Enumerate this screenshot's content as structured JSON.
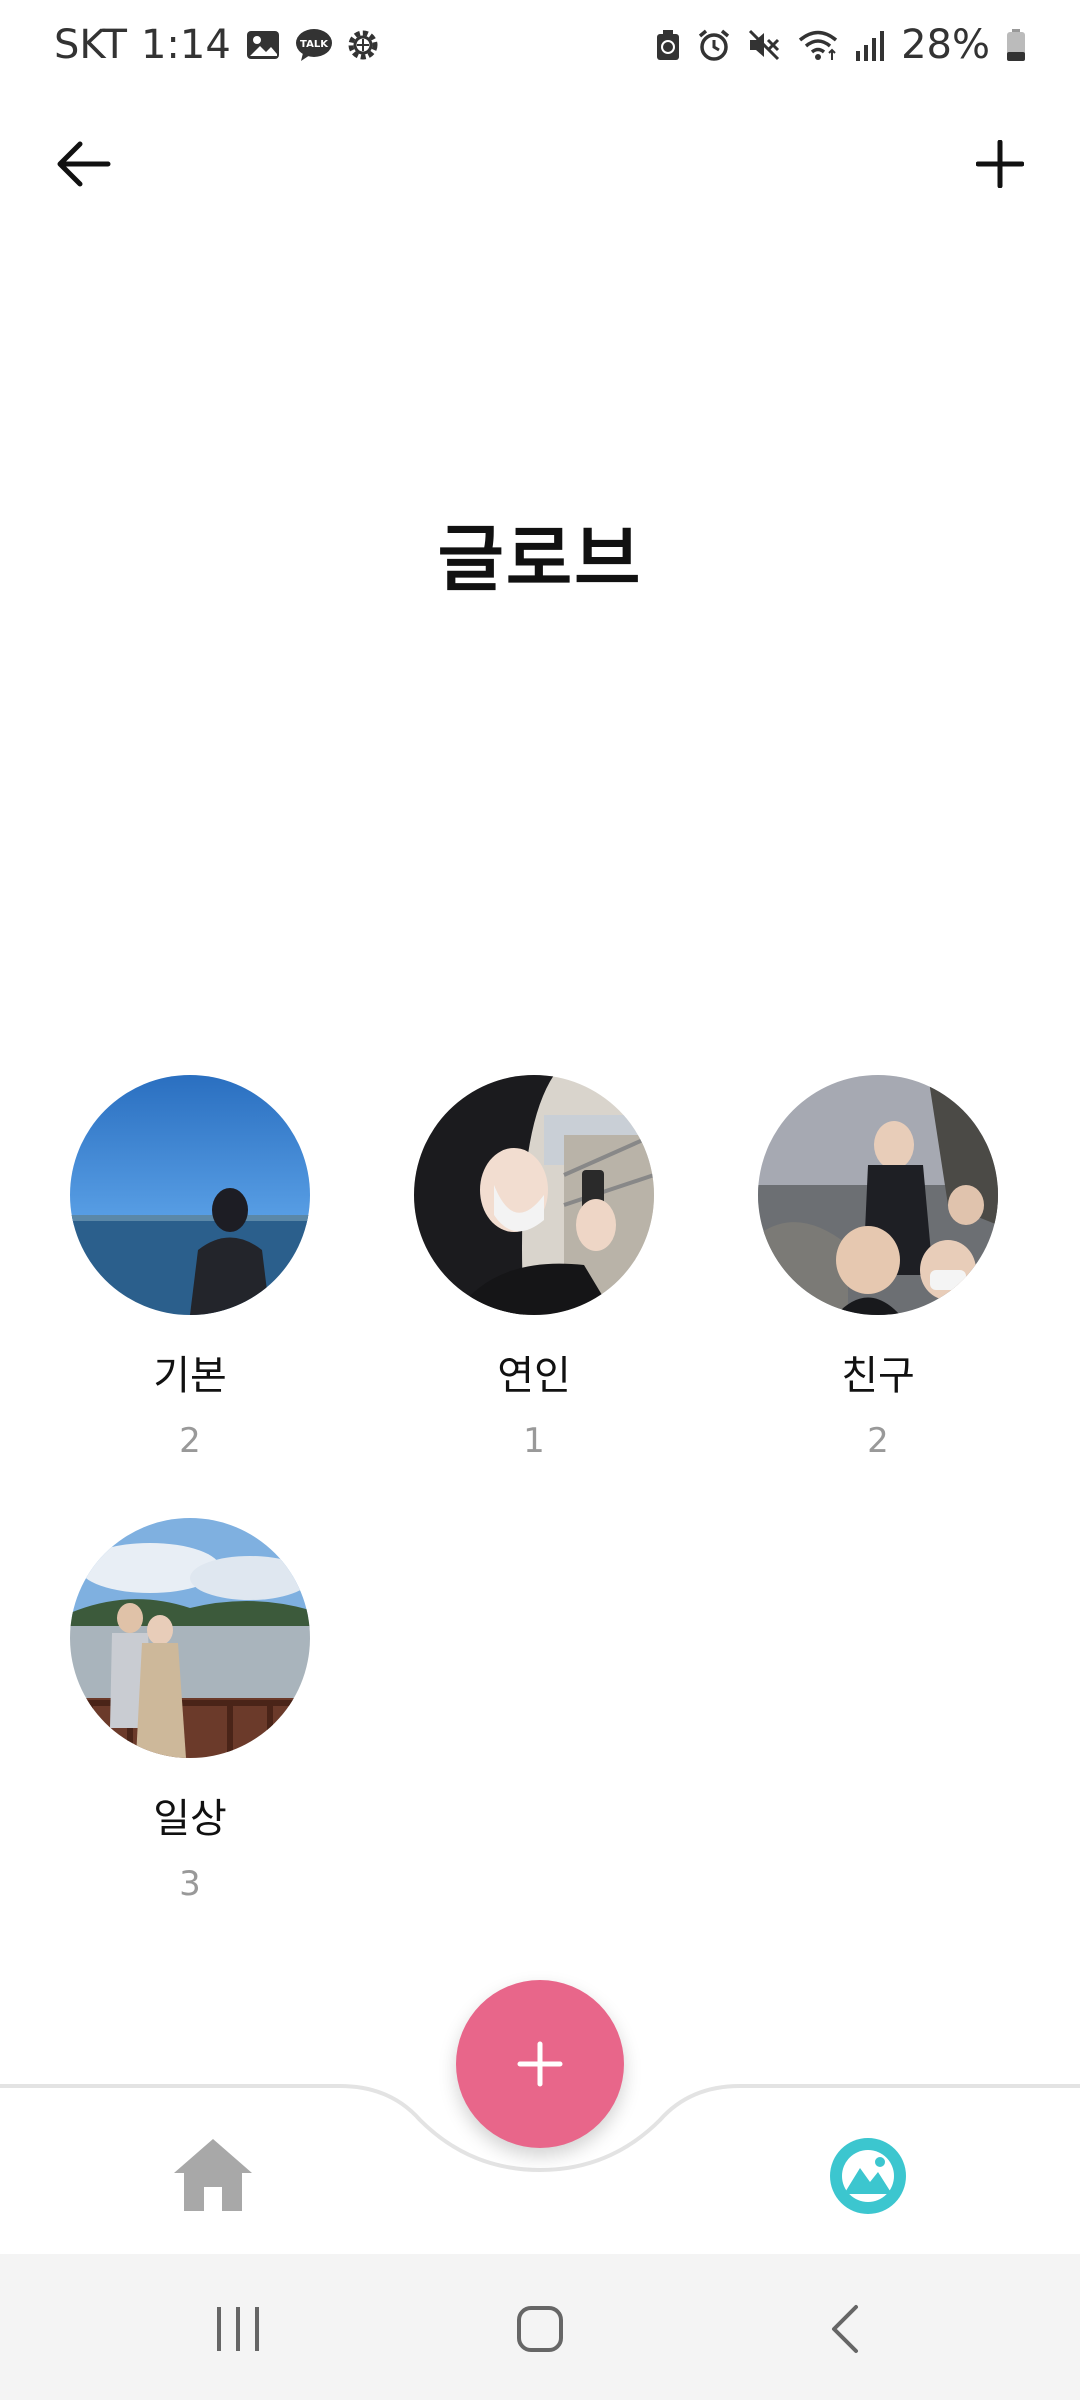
{
  "status_bar": {
    "carrier": "SKT",
    "time": "1:14",
    "battery": "28%",
    "left_icons": [
      "image-icon",
      "talk-icon",
      "settings-icon"
    ],
    "right_icons": [
      "recycle-icon",
      "alarm-icon",
      "mute-icon",
      "wifi-icon",
      "signal-icon",
      "battery-icon"
    ]
  },
  "header": {
    "back_icon": "arrow-left-icon",
    "add_icon": "plus-icon",
    "title": "글로브"
  },
  "albums": [
    {
      "name": "기본",
      "count": "2"
    },
    {
      "name": "연인",
      "count": "1"
    },
    {
      "name": "친구",
      "count": "2"
    },
    {
      "name": "일상",
      "count": "3"
    }
  ],
  "bottom_nav": {
    "home_icon": "home-icon",
    "fab_icon": "plus-icon",
    "gallery_icon": "gallery-icon",
    "accent_color": "#e8668a",
    "active_color": "#3cc6cf"
  },
  "system_nav": [
    "recent-apps-icon",
    "home-circle-icon",
    "back-chevron-icon"
  ]
}
